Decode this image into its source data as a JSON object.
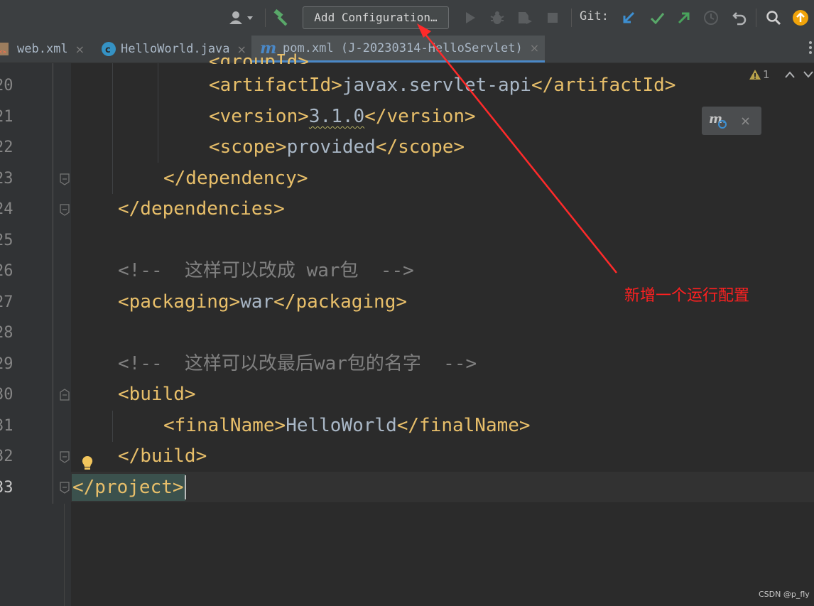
{
  "toolbar": {
    "add_config_label": "Add Configuration…",
    "git_label": "Git:"
  },
  "tabs": [
    {
      "label": "web.xml",
      "active": false
    },
    {
      "label": "HelloWorld.java",
      "active": false
    },
    {
      "label": "pom.xml (J-20230314-HelloServlet)",
      "active": true
    }
  ],
  "tab_close_glyph": "×",
  "editor": {
    "line_numbers": [
      "20",
      "21",
      "22",
      "23",
      "24",
      "25",
      "26",
      "27",
      "28",
      "29",
      "30",
      "31",
      "32",
      "33"
    ],
    "lines": {
      "l20_open": "<artifactId>",
      "l20_text": "javax.servlet-api",
      "l20_close": "</artifactId>",
      "l21_open": "<version>",
      "l21_text": "3.1.0",
      "l21_close": "</version>",
      "l22_open": "<scope>",
      "l22_text": "provided",
      "l22_close": "</scope>",
      "l23": "</dependency>",
      "l24": "</dependencies>",
      "l26": "<!--  这样可以改成 war包  -->",
      "l27_open": "<packaging>",
      "l27_text": "war",
      "l27_close": "</packaging>",
      "l29": "<!--  这样可以改最后war包的名字  -->",
      "l30": "<build>",
      "l31_open": "<finalName>",
      "l31_text": "HelloWorld",
      "l31_close": "</finalName>",
      "l32": "</build>",
      "l33": "</project>"
    }
  },
  "inspections": {
    "warning_count": "1"
  },
  "annotation": "新增一个运行配置",
  "watermark": "CSDN @p_fly",
  "colors": {
    "tag": "#e8bf6a",
    "text": "#a9b7c6",
    "comment": "#808080",
    "annotation": "#ff2020",
    "git_update": "#3d8fd1",
    "git_commit": "#59a869",
    "git_push": "#49a35c"
  }
}
